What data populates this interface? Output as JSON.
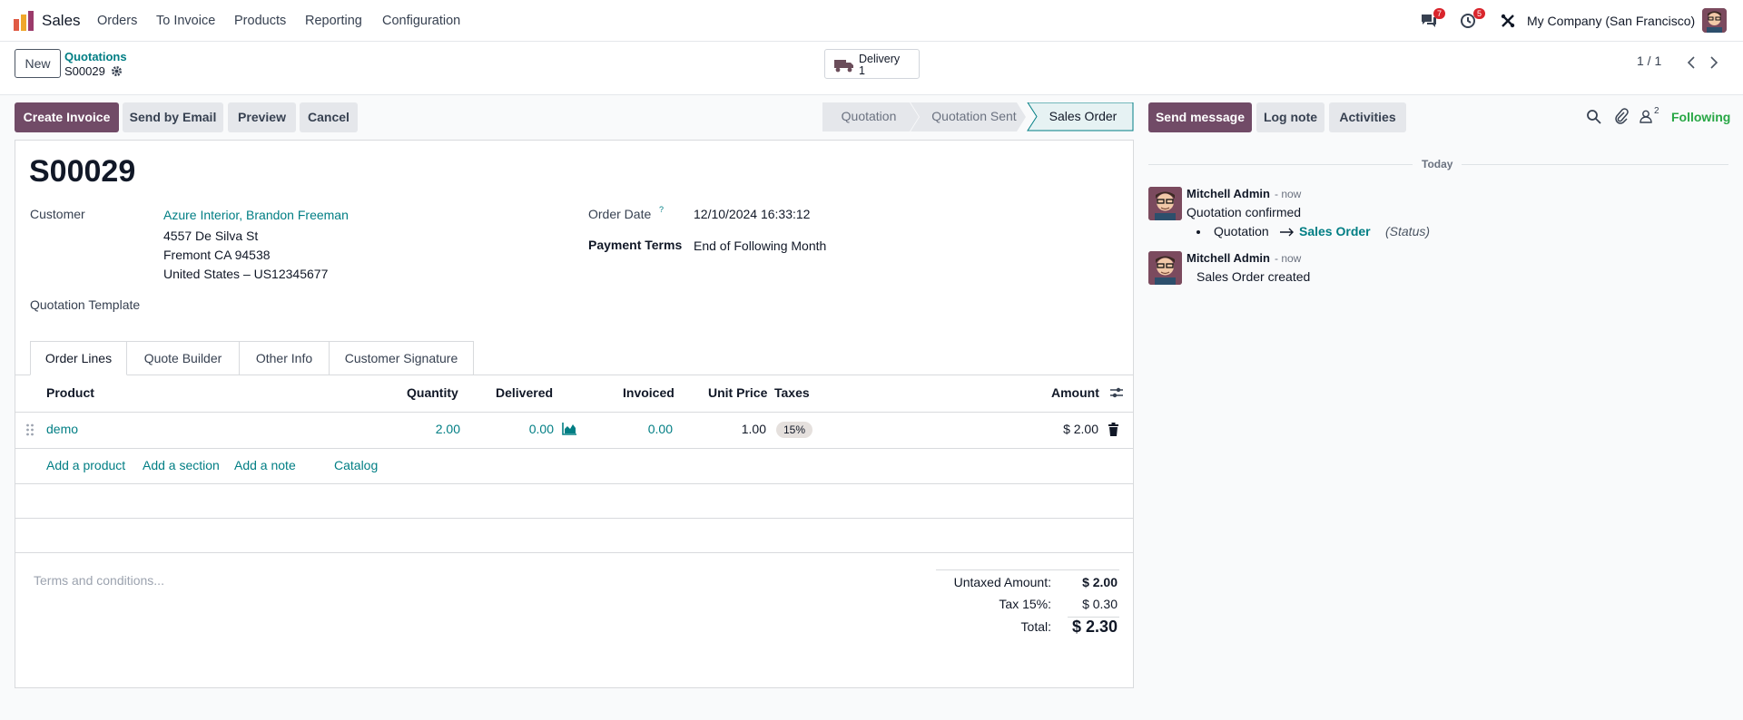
{
  "app": {
    "name": "Sales",
    "menu": [
      "Orders",
      "To Invoice",
      "Products",
      "Reporting",
      "Configuration"
    ],
    "messages_count": "7",
    "activities_count": "5",
    "company": "My Company (San Francisco)"
  },
  "control_panel": {
    "new_label": "New",
    "breadcrumb_parent": "Quotations",
    "breadcrumb_current": "S00029",
    "delivery_label": "Delivery",
    "delivery_count": "1",
    "pager": "1 / 1"
  },
  "actions": {
    "create_invoice": "Create Invoice",
    "send_by_email": "Send by Email",
    "preview": "Preview",
    "cancel": "Cancel"
  },
  "statusbar": [
    "Quotation",
    "Quotation Sent",
    "Sales Order"
  ],
  "record": {
    "name": "S00029",
    "customer_label": "Customer",
    "customer_name": "Azure Interior, Brandon Freeman",
    "address_line1": "4557 De Silva St",
    "address_line2": "Fremont CA 94538",
    "address_line3": "United States – US12345677",
    "template_label": "Quotation Template",
    "order_date_label": "Order Date",
    "order_date_help": "?",
    "order_date": "12/10/2024 16:33:12",
    "payment_terms_label": "Payment Terms",
    "payment_terms": "End of Following Month"
  },
  "tabs": [
    "Order Lines",
    "Quote Builder",
    "Other Info",
    "Customer Signature"
  ],
  "order_lines": {
    "headers": {
      "product": "Product",
      "quantity": "Quantity",
      "delivered": "Delivered",
      "invoiced": "Invoiced",
      "unit_price": "Unit Price",
      "taxes": "Taxes",
      "amount": "Amount"
    },
    "rows": [
      {
        "product": "demo",
        "quantity": "2.00",
        "delivered": "0.00",
        "invoiced": "0.00",
        "unit_price": "1.00",
        "tax": "15%",
        "amount": "$ 2.00"
      }
    ],
    "add_product": "Add a product",
    "add_section": "Add a section",
    "add_note": "Add a note",
    "catalog": "Catalog"
  },
  "terms_placeholder": "Terms and conditions...",
  "totals": {
    "untaxed_label": "Untaxed Amount:",
    "untaxed": "$ 2.00",
    "tax_label": "Tax 15%:",
    "tax": "$ 0.30",
    "total_label": "Total:",
    "total": "$ 2.30"
  },
  "chatter": {
    "send_message": "Send message",
    "log_note": "Log note",
    "activities": "Activities",
    "followers_count": "2",
    "following": "Following",
    "date_separator": "Today",
    "messages": [
      {
        "author": "Mitchell Admin",
        "time": "- now",
        "body": "Quotation confirmed",
        "tracking_old": "Quotation",
        "tracking_new": "Sales Order",
        "tracking_field": "(Status)"
      },
      {
        "author": "Mitchell Admin",
        "time": "- now",
        "body": "Sales Order created"
      }
    ]
  },
  "colors": {
    "primary": "#714b67",
    "link": "#017e84",
    "following": "#28a745"
  }
}
